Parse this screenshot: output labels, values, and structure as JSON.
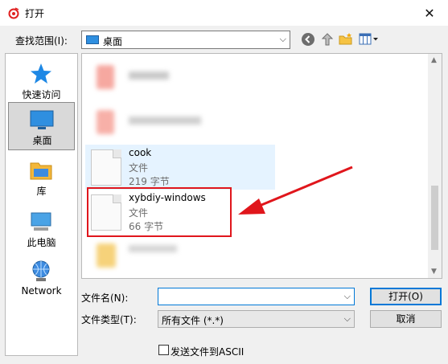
{
  "window": {
    "title": "打开",
    "close_glyph": "✕"
  },
  "lookin": {
    "label": "查找范围(I):",
    "value": "桌面"
  },
  "places": [
    {
      "label": "快速访问",
      "icon": "star-icon"
    },
    {
      "label": "桌面",
      "icon": "desktop-icon",
      "selected": true
    },
    {
      "label": "库",
      "icon": "library-icon"
    },
    {
      "label": "此电脑",
      "icon": "computer-icon"
    },
    {
      "label": "Network",
      "icon": "network-icon"
    }
  ],
  "files": [
    {
      "name": "cook",
      "type": "文件",
      "size": "219 字节"
    },
    {
      "name": "xybdiy-windows",
      "type": "文件",
      "size": "66 字节"
    }
  ],
  "filename": {
    "label": "文件名(N):",
    "value": ""
  },
  "filetype": {
    "label": "文件类型(T):",
    "value": "所有文件 (*.*)"
  },
  "buttons": {
    "open": "打开(O)",
    "cancel": "取消"
  },
  "ascii_option": {
    "label": "发送文件到ASCII",
    "checked": false
  },
  "colors": {
    "accent": "#0078d7",
    "annotation": "#e0161c",
    "hover": "#e5f3ff"
  }
}
